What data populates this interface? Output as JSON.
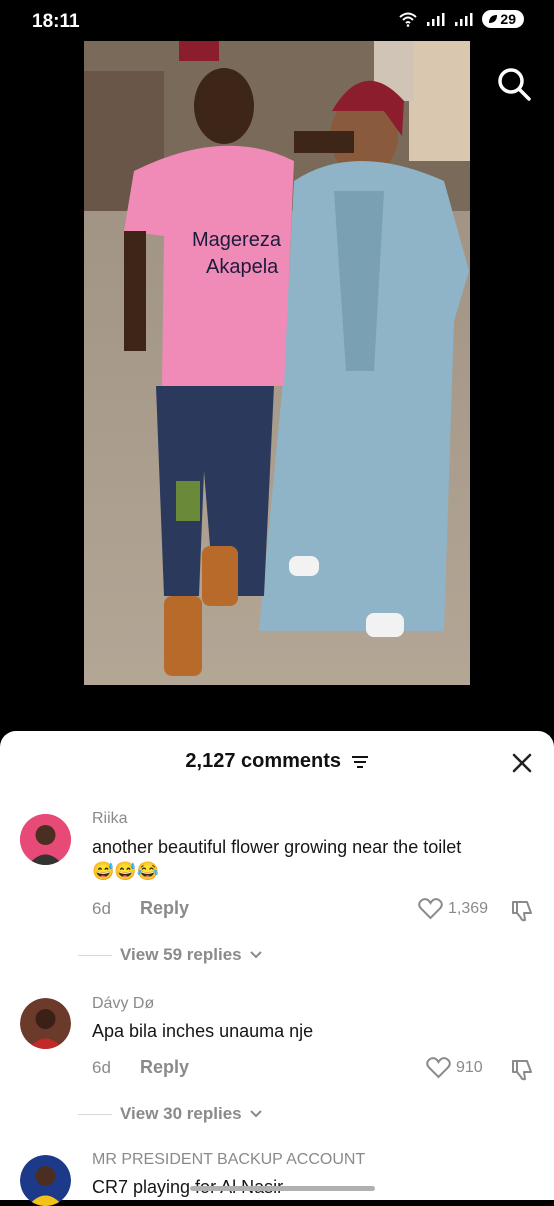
{
  "status": {
    "time": "18:11",
    "battery": "29"
  },
  "video": {
    "shirt_text_1": "Magereza",
    "shirt_text_2": "Akapela"
  },
  "sheet": {
    "title": "2,127 comments"
  },
  "comments": [
    {
      "user": "Riika",
      "text": "another beautiful flower growing near the toilet",
      "emoji": "😅😅😂",
      "age": "6d",
      "reply_label": "Reply",
      "likes": "1,369",
      "view_replies": "View 59 replies"
    },
    {
      "user": "Dávy Dø",
      "text": "Apa bila inches unauma nje",
      "age": "6d",
      "reply_label": "Reply",
      "likes": "910",
      "view_replies": "View 30 replies"
    },
    {
      "user": "MR PRESIDENT BACKUP ACCOUNT",
      "text": "CR7 playing for Al Nasir"
    }
  ],
  "icons": [
    "wifi-icon",
    "signal-icon",
    "battery-icon",
    "search-icon",
    "filter-icon",
    "close-icon",
    "heart-icon",
    "dislike-icon",
    "chevron-down-icon"
  ]
}
